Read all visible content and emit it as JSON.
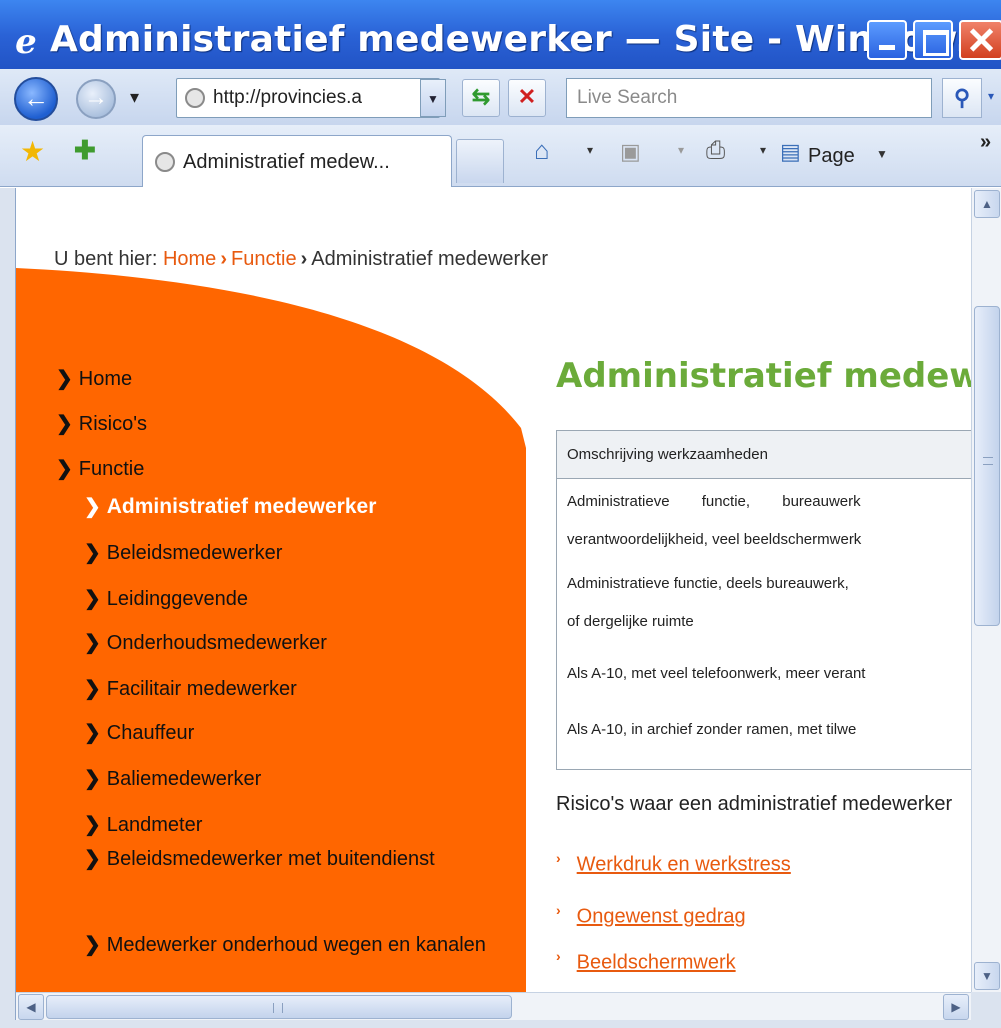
{
  "window": {
    "title": "Administratief medewerker — Site - Window..."
  },
  "toolbar": {
    "address": "http://provincies.a",
    "search_placeholder": "Live Search",
    "tab_label": "Administratief medew...",
    "page_label": "Page",
    "chevron": "»"
  },
  "breadcrumb": {
    "prefix": "U bent hier:",
    "items": [
      "Home",
      "Functie",
      "Administratief medewerker"
    ]
  },
  "nav": {
    "top_items": [
      "Home",
      "Risico's",
      "Functie"
    ],
    "sub_items": [
      "Administratief medewerker",
      "Beleidsmedewerker",
      "Leidinggevende",
      "Onderhoudsmedewerker",
      "Facilitair medewerker",
      "Chauffeur",
      "Baliemedewerker",
      "Landmeter",
      "Beleidsmedewerker met buitendienst",
      "Medewerker onderhoud wegen en kanalen"
    ],
    "active_index": 0
  },
  "content": {
    "heading": "Administratief medewerker",
    "table_header": "Omschrijving werkzaamheden",
    "rows": [
      "Administratieve functie, bureauwerk",
      "verantwoordelijkheid, veel beeldschermwerk",
      "Administratieve functie, deels bureauwerk,",
      "of dergelijke ruimte",
      "Als A-10, met veel telefoonwerk, meer verant",
      "Als A-10, in archief zonder ramen, met tilwe"
    ],
    "risks_intro": "Risico's waar een administratief medewerker",
    "risks": [
      "Werkdruk en werkstress",
      "Ongewenst gedrag",
      "Beeldschermwerk"
    ]
  },
  "colors": {
    "orange": "#ff6600",
    "link": "#e85a0f",
    "heading_green": "#6bab3a"
  }
}
